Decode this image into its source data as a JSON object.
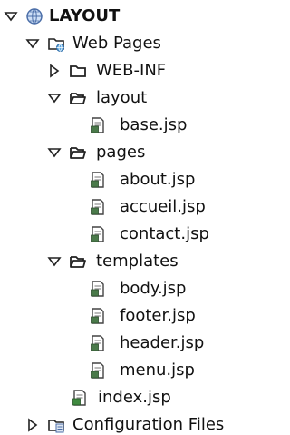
{
  "tree": {
    "root": {
      "label": "LAYOUT",
      "icon": "globe-project-icon",
      "expanded": true
    },
    "items": [
      {
        "label": "Web Pages",
        "icon": "web-folder-icon",
        "expanded": true
      },
      {
        "label": "WEB-INF",
        "icon": "folder-icon",
        "expanded": false
      },
      {
        "label": "layout",
        "icon": "folder-open-icon",
        "expanded": true
      },
      {
        "label": "base.jsp",
        "icon": "jsp-file-icon"
      },
      {
        "label": "pages",
        "icon": "folder-open-icon",
        "expanded": true
      },
      {
        "label": "about.jsp",
        "icon": "jsp-file-icon"
      },
      {
        "label": "accueil.jsp",
        "icon": "jsp-file-icon"
      },
      {
        "label": "contact.jsp",
        "icon": "jsp-file-icon"
      },
      {
        "label": "templates",
        "icon": "folder-open-icon",
        "expanded": true
      },
      {
        "label": "body.jsp",
        "icon": "jsp-file-icon"
      },
      {
        "label": "footer.jsp",
        "icon": "jsp-file-icon"
      },
      {
        "label": "header.jsp",
        "icon": "jsp-file-icon"
      },
      {
        "label": "menu.jsp",
        "icon": "jsp-file-icon"
      },
      {
        "label": "index.jsp",
        "icon": "jsp-index-icon"
      },
      {
        "label": "Configuration Files",
        "icon": "config-files-icon",
        "expanded": false
      }
    ]
  }
}
